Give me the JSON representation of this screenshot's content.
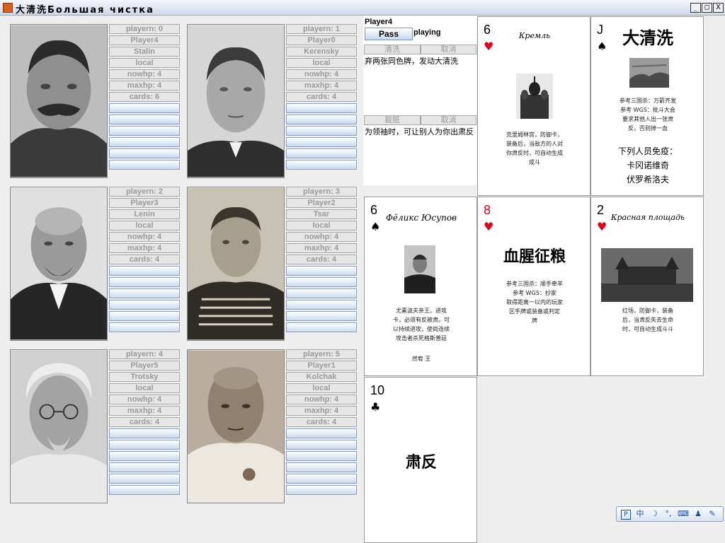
{
  "window": {
    "title": "大清洗Большая чистка",
    "controls": {
      "minimize": "_",
      "maximize": "□",
      "close": "X"
    }
  },
  "players": [
    {
      "index": "playern: 0",
      "player": "Player4",
      "name": "Stalin",
      "type": "local",
      "nowhp": "nowhp: 4",
      "maxhp": "maxhp: 4",
      "cards": "cards: 6"
    },
    {
      "index": "playern: 1",
      "player": "Player0",
      "name": "Kerensky",
      "type": "local",
      "nowhp": "nowhp: 4",
      "maxhp": "maxhp: 4",
      "cards": "cards: 4"
    },
    {
      "index": "playern: 2",
      "player": "Player3",
      "name": "Lenin",
      "type": "local",
      "nowhp": "nowhp: 4",
      "maxhp": "maxhp: 4",
      "cards": "cards: 4"
    },
    {
      "index": "playern: 3",
      "player": "Player2",
      "name": "Tsar",
      "type": "local",
      "nowhp": "nowhp: 4",
      "maxhp": "maxhp: 4",
      "cards": "cards: 4"
    },
    {
      "index": "playern: 4",
      "player": "Player5",
      "name": "Trotsky",
      "type": "local",
      "nowhp": "nowhp: 4",
      "maxhp": "maxhp: 4",
      "cards": "cards: 4"
    },
    {
      "index": "playern: 5",
      "player": "Player1",
      "name": "Kolchak",
      "type": "local",
      "nowhp": "nowhp: 4",
      "maxhp": "maxhp: 4",
      "cards": "cards: 4"
    }
  ],
  "control": {
    "current_player": "Player4",
    "pass": "Pass",
    "status": "playing",
    "skill1": {
      "action": "清洗",
      "cancel": "取消",
      "desc": "弃两张同色牌，发动大清洗"
    },
    "skill2": {
      "action": "裁赃",
      "cancel": "取消",
      "desc": "为领袖时，可让别人为你出肃反"
    }
  },
  "cards": [
    {
      "rank": "6",
      "suit": "♥",
      "color": "#e3001b",
      "title": "Кремль",
      "picture": "kremlin-photo",
      "desc": [
        "克里姆林宫，防御卡，",
        "装备后，当敌方的人对",
        "你肃反时，可自动生成",
        "成斗"
      ]
    },
    {
      "rank": "J",
      "suit": "♠",
      "color": "#000000",
      "title": "大清洗",
      "picture": "purge-photo",
      "desc": [
        "参考三国杀：万箭齐发",
        "参考 WGS：批斗大会",
        "要求其他人出一张肃",
        "反，否则掉一血"
      ],
      "desc2": [
        "下列人员免疫：",
        "卡冈诺维奇",
        "伏罗希洛夫"
      ]
    },
    {
      "rank": "6",
      "suit": "♠",
      "color": "#000000",
      "title": "Фёликс Юсупов",
      "picture": "yusupov-photo",
      "desc": [
        "尤素波夫亲王，进攻",
        "卡，必须有反被肃。可",
        "以持续进攻，使尚连续",
        "攻击者杀死格斯普廷"
      ],
      "sign": "然宥 王"
    },
    {
      "rank": "8",
      "suit": "♥",
      "color": "#e3001b",
      "title": "血腥征粮",
      "desc": [
        "参考三国杀：顺手牵羊",
        "参考 WGS：抄家",
        "取得距离一以内的玩家",
        "区手牌或装备或判定",
        "牌"
      ]
    },
    {
      "rank": "2",
      "suit": "♥",
      "color": "#e3001b",
      "title": "Красная площадь",
      "picture": "red-square-photo",
      "desc": [
        "红场，防御卡，装备",
        "后，当肃反失去生命",
        "时，可自动生成斗斗"
      ]
    },
    {
      "rank": "10",
      "suit": "♣",
      "color": "#000000",
      "title": "肃反"
    }
  ],
  "tray": {
    "icons": [
      "ime-icon",
      "zh-icon",
      "moon-icon",
      "punct-icon",
      "keyboard-icon",
      "user-icon",
      "wrench-icon"
    ],
    "zh": "中"
  }
}
